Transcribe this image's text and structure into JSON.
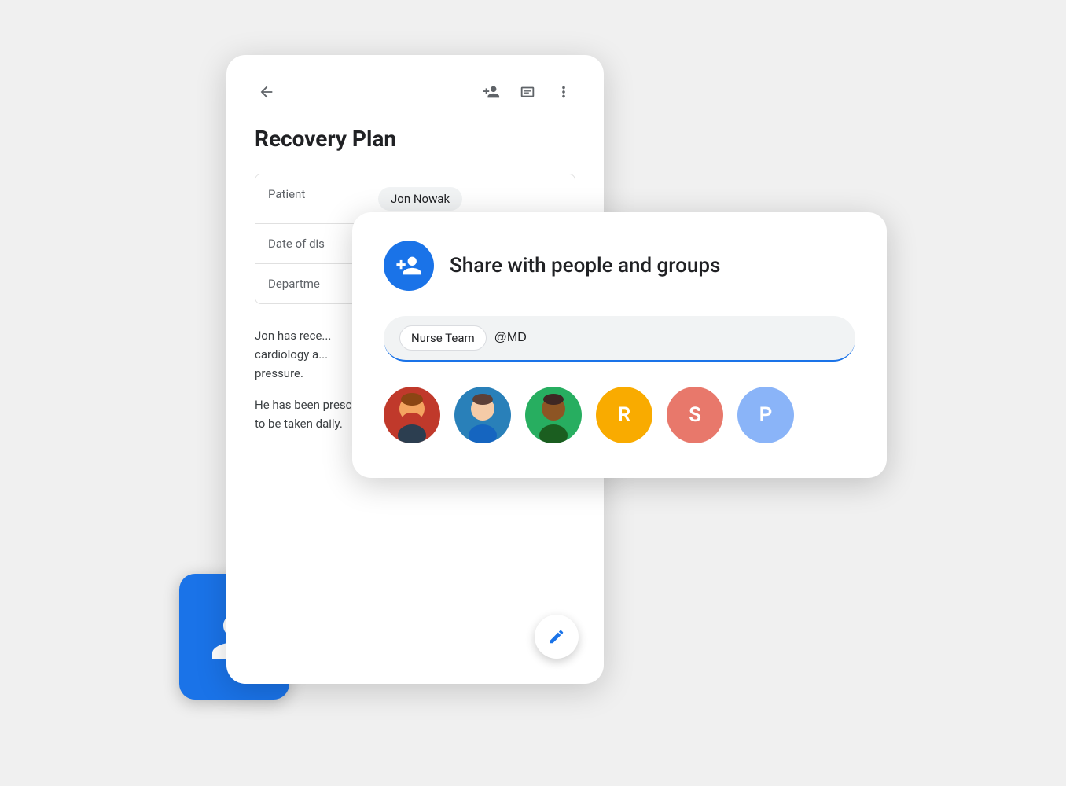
{
  "doc_card": {
    "title": "Recovery Plan",
    "table": {
      "rows": [
        {
          "label": "Patient",
          "value": "Jon Nowak",
          "is_chip": true
        },
        {
          "label": "Date of dis",
          "value": ""
        },
        {
          "label": "Departme",
          "value": ""
        }
      ]
    },
    "paragraphs": [
      "Jon has rece... cardiology a... pressure.",
      "He has been prescribed lisinopril, to be taken daily."
    ]
  },
  "share_dialog": {
    "title": "Share with people and groups",
    "input_chip": "Nurse Team",
    "input_value": "@MD",
    "input_placeholder": "@MD",
    "avatars": [
      {
        "type": "photo",
        "label": "person-1",
        "color": ""
      },
      {
        "type": "photo",
        "label": "person-2",
        "color": ""
      },
      {
        "type": "photo",
        "label": "person-3",
        "color": ""
      },
      {
        "type": "letter",
        "letter": "R",
        "color_class": "avatar-R"
      },
      {
        "type": "letter",
        "letter": "S",
        "color_class": "avatar-S"
      },
      {
        "type": "letter",
        "letter": "P",
        "color_class": "avatar-P"
      }
    ]
  },
  "icons": {
    "back": "←",
    "add_person": "person_add",
    "notes": "notes",
    "more": "···",
    "edit": "✏️"
  }
}
